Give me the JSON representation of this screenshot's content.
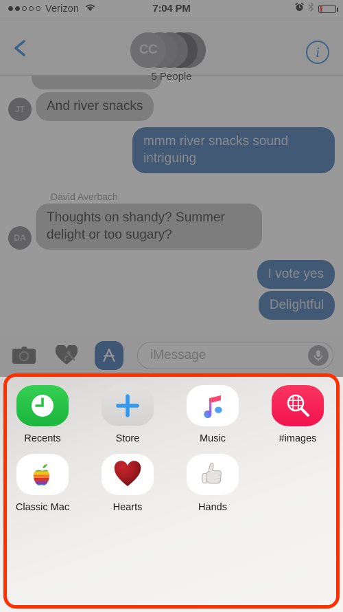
{
  "status_bar": {
    "carrier": "Verizon",
    "signal_dots_filled": 2,
    "signal_dots_total": 5,
    "wifi_icon": "wifi-icon",
    "time": "7:04 PM",
    "alarm_icon": "alarm-clock-icon",
    "bluetooth_icon": "bluetooth-icon",
    "battery_icon": "battery-low-icon",
    "battery_color": "#ff3b30"
  },
  "nav_bar": {
    "back_icon": "back-chevron-icon",
    "info_icon": "info-circle-icon",
    "info_label": "i",
    "accent_color": "#0b6fd4",
    "avatar_initials": "CC",
    "group_name": "5 People"
  },
  "conversation": {
    "messages": [
      {
        "id": "msg-partial",
        "direction": "incoming",
        "text": "",
        "partial": true
      },
      {
        "id": "msg-river-snacks",
        "direction": "incoming",
        "avatar_initials": "JT",
        "text": "And river snacks"
      },
      {
        "id": "msg-intriguing",
        "direction": "outgoing",
        "text": "mmm river snacks sound intriguing"
      },
      {
        "id": "msg-shandy",
        "direction": "incoming",
        "avatar_initials": "DA",
        "sender": "David Averbach",
        "text": "Thoughts on shandy? Summer delight or too sugary?"
      },
      {
        "id": "msg-vote-yes",
        "direction": "outgoing",
        "text": "I vote yes"
      },
      {
        "id": "msg-delightful",
        "direction": "outgoing",
        "text": "Delightful"
      }
    ],
    "incoming_bubble_color": "#b5b5b8",
    "outgoing_bubble_color": "#1858a0"
  },
  "toolbar": {
    "camera_icon": "camera-icon",
    "digital_touch_icon": "digital-touch-heart-icon",
    "app_store_icon": "imessage-app-store-icon",
    "message_placeholder": "iMessage",
    "message_value": "",
    "mic_icon": "microphone-icon"
  },
  "app_drawer": {
    "highlight_color": "#ff3000",
    "apps": [
      {
        "id": "app-recents",
        "label": "Recents",
        "icon": "clock-icon",
        "bg": "#2dc44a"
      },
      {
        "id": "app-store",
        "label": "Store",
        "icon": "plus-icon",
        "bg": "#dcdcdc"
      },
      {
        "id": "app-music",
        "label": "Music",
        "icon": "music-note-icon",
        "bg": "#ffffff"
      },
      {
        "id": "app-images",
        "label": "#images",
        "icon": "image-search-icon",
        "bg": "#f8315c"
      },
      {
        "id": "app-classic-mac",
        "label": "Classic Mac",
        "icon": "rainbow-apple-icon",
        "bg": "#ffffff"
      },
      {
        "id": "app-hearts",
        "label": "Hearts",
        "icon": "red-heart-icon",
        "bg": "#ffffff"
      },
      {
        "id": "app-hands",
        "label": "Hands",
        "icon": "thumbs-up-icon",
        "bg": "#ffffff"
      }
    ]
  }
}
